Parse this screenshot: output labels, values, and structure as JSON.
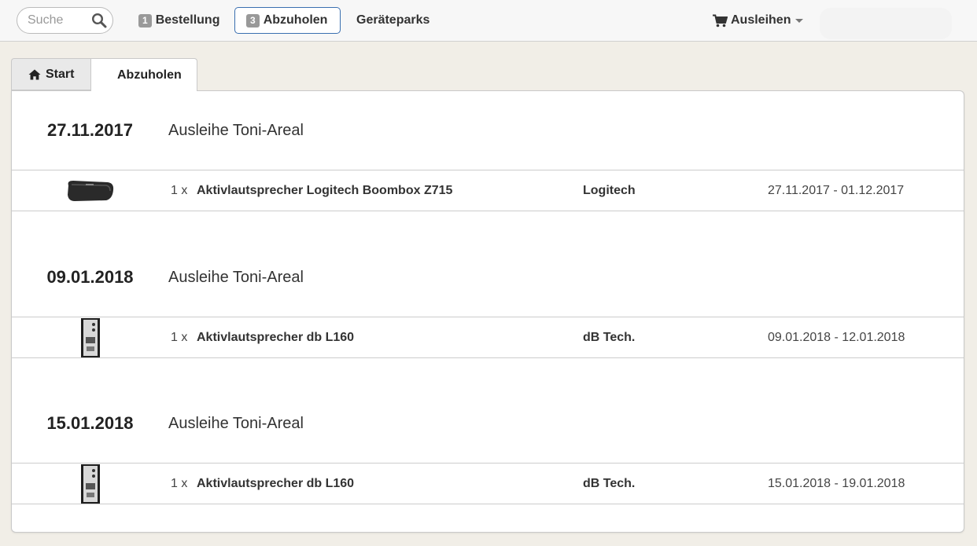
{
  "search": {
    "placeholder": "Suche"
  },
  "nav": {
    "order": {
      "badge": "1",
      "label": "Bestellung"
    },
    "pickup": {
      "badge": "3",
      "label": "Abzuholen"
    },
    "parks": {
      "label": "Geräteparks"
    },
    "lend": {
      "label": "Ausleihen"
    }
  },
  "breadcrumb": {
    "start": "Start",
    "current": "Abzuholen"
  },
  "groups": [
    {
      "date": "27.11.2017",
      "title": "Ausleihe Toni-Areal",
      "item": {
        "qty": "1 x",
        "name": "Aktivlautsprecher Logitech Boombox Z715",
        "brand": "Logitech",
        "range": "27.11.2017 - 01.12.2017",
        "thumb": "boombox"
      }
    },
    {
      "date": "09.01.2018",
      "title": "Ausleihe Toni-Areal",
      "item": {
        "qty": "1 x",
        "name": "Aktivlautsprecher db L160",
        "brand": "dB Tech.",
        "range": "09.01.2018 - 12.01.2018",
        "thumb": "speaker"
      }
    },
    {
      "date": "15.01.2018",
      "title": "Ausleihe Toni-Areal",
      "item": {
        "qty": "1 x",
        "name": "Aktivlautsprecher db L160",
        "brand": "dB Tech.",
        "range": "15.01.2018 - 19.01.2018",
        "thumb": "speaker"
      }
    }
  ]
}
